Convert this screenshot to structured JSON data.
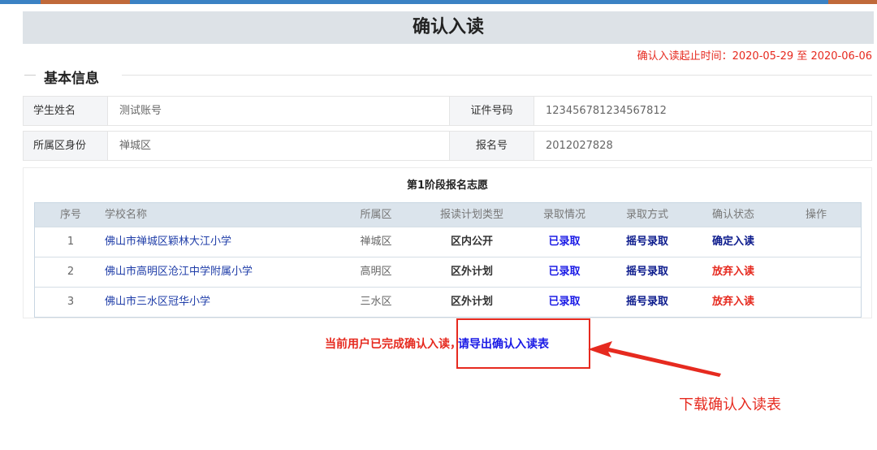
{
  "page_title": "确认入读",
  "period": {
    "label": "确认入读起止时间：",
    "start": "2020-05-29",
    "separator": " 至 ",
    "end": "2020-06-06"
  },
  "section_title": "基本信息",
  "student": {
    "name_label": "学生姓名",
    "name_value": "测试账号",
    "id_label": "证件号码",
    "id_value": "123456781234567812",
    "district_label": "所属区身份",
    "district_value": "禅城区",
    "reg_label": "报名号",
    "reg_value": "2012027828"
  },
  "wish_table": {
    "caption": "第1阶段报名志愿",
    "headers": [
      "序号",
      "学校名称",
      "所属区",
      "报读计划类型",
      "录取情况",
      "录取方式",
      "确认状态",
      "操作"
    ],
    "rows": [
      {
        "no": "1",
        "school": "佛山市禅城区颖林大江小学",
        "district": "禅城区",
        "plan": "区内公开",
        "admission": "已录取",
        "method": "摇号录取",
        "status": "确定入读",
        "action": ""
      },
      {
        "no": "2",
        "school": "佛山市高明区沧江中学附属小学",
        "district": "高明区",
        "plan": "区外计划",
        "admission": "已录取",
        "method": "摇号录取",
        "status": "放弃入读",
        "action": ""
      },
      {
        "no": "3",
        "school": "佛山市三水区冠华小学",
        "district": "三水区",
        "plan": "区外计划",
        "admission": "已录取",
        "method": "摇号录取",
        "status": "放弃入读",
        "action": ""
      }
    ]
  },
  "notice": {
    "done_text": "当前用户已完成确认入读，",
    "export_link": "请导出确认入读表"
  },
  "annotation": "下载确认入读表",
  "colors": {
    "accent_red": "#e62a1f",
    "link_blue": "#1a1ae6",
    "title_bar": "#dde2e7",
    "header_row": "#dbe4ec"
  }
}
